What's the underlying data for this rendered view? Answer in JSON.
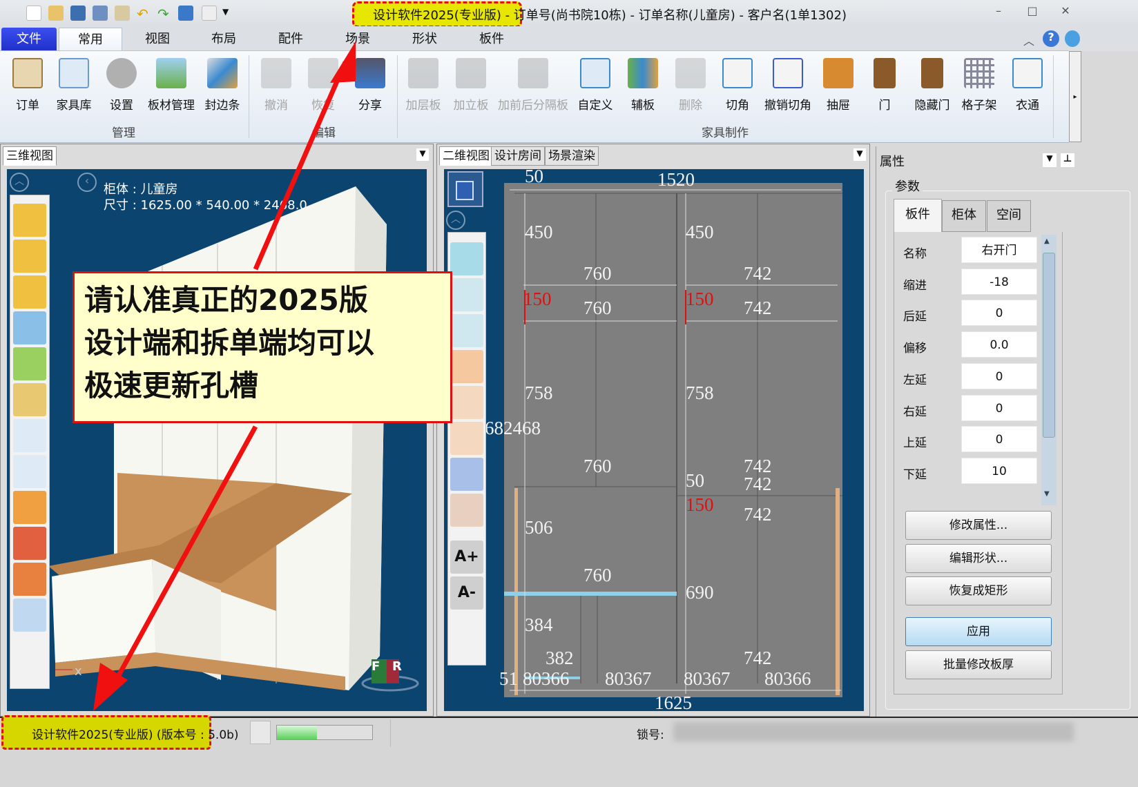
{
  "titlebar": {
    "title": "设计软件2025(专业版) - 订单号(尚书院10栋) - 订单名称(儿童房) - 客户名(1单1302)",
    "minimize": "–",
    "maximize": "□",
    "close": "✕"
  },
  "menu": {
    "file": "文件",
    "tabs": [
      "常用",
      "视图",
      "布局",
      "配件",
      "场景",
      "形状",
      "板件"
    ]
  },
  "ribbon": {
    "groups": [
      "管理",
      "编辑",
      "家具制作"
    ],
    "buttons": [
      "订单",
      "家具库",
      "设置",
      "板材管理",
      "封边条",
      "撤消",
      "恢复",
      "分享",
      "加层板",
      "加立板",
      "加前后分隔板",
      "自定义",
      "辅板",
      "删除",
      "切角",
      "撤销切角",
      "抽屉",
      "门",
      "隐藏门",
      "格子架",
      "衣通"
    ],
    "colors": {
      "accent": "#1f2fc8",
      "highlight": "#e6e600",
      "alert": "#e01010"
    }
  },
  "view3d": {
    "tab": "三维视图",
    "cabinet_label": "柜体 : 儿童房",
    "size_label": "尺寸 : 1625.00 * 540.00 * 2468.0",
    "axis_x": "x",
    "gizmo_f": "F",
    "gizmo_r": "R"
  },
  "view2d": {
    "tabs": [
      "二维视图",
      "设计房间",
      "场景渲染"
    ],
    "font_plus": "A+",
    "font_minus": "A-",
    "dims": [
      {
        "t": "50"
      },
      {
        "t": "1520"
      },
      {
        "t": "450"
      },
      {
        "t": "450"
      },
      {
        "t": "760"
      },
      {
        "t": "742"
      },
      {
        "t": "150"
      },
      {
        "t": "760"
      },
      {
        "t": "150"
      },
      {
        "t": "742"
      },
      {
        "t": "758"
      },
      {
        "t": "758"
      },
      {
        "t": "682468"
      },
      {
        "t": "760"
      },
      {
        "t": "742"
      },
      {
        "t": "50"
      },
      {
        "t": "742"
      },
      {
        "t": "150"
      },
      {
        "t": "742"
      },
      {
        "t": "506"
      },
      {
        "t": "760"
      },
      {
        "t": "690"
      },
      {
        "t": "384"
      },
      {
        "t": "382"
      },
      {
        "t": "742"
      },
      {
        "t": "51"
      },
      {
        "t": "80366"
      },
      {
        "t": "80367"
      },
      {
        "t": "80367"
      },
      {
        "t": "80366"
      },
      {
        "t": "1625"
      }
    ]
  },
  "properties": {
    "title": "属性",
    "group": "参数",
    "tabs": [
      "板件",
      "柜体",
      "空间"
    ],
    "rows": [
      {
        "label": "名称",
        "value": "右开门"
      },
      {
        "label": "缩进",
        "value": "-18"
      },
      {
        "label": "后延",
        "value": "0"
      },
      {
        "label": "偏移",
        "value": "0.0"
      },
      {
        "label": "左延",
        "value": "0"
      },
      {
        "label": "右延",
        "value": "0"
      },
      {
        "label": "上延",
        "value": "0"
      },
      {
        "label": "下延",
        "value": "10"
      }
    ],
    "buttons": [
      "修改属性...",
      "编辑形状...",
      "恢复成矩形",
      "应用",
      "批量修改板厚"
    ]
  },
  "callout": {
    "lines": [
      "请认准真正的2025版",
      "设计端和拆单端均可以",
      "极速更新孔槽"
    ]
  },
  "statusbar": {
    "version": "设计软件2025(专业版) (版本号 : 5.0b)",
    "lock_label": "锁号:",
    "progress": 0.42
  }
}
